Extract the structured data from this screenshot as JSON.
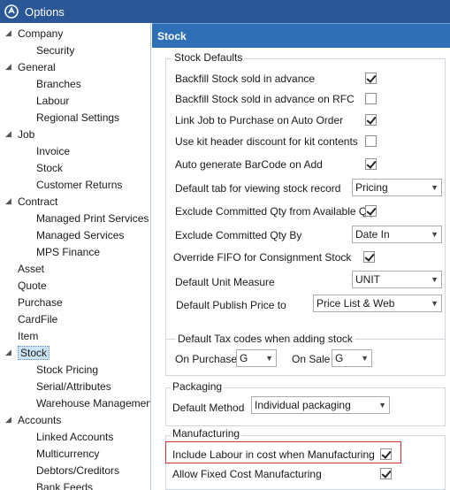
{
  "window": {
    "title": "Options",
    "app_icon": "app-logo-icon"
  },
  "tree": {
    "items": [
      {
        "label": "Company",
        "level": 0,
        "expanded": true
      },
      {
        "label": "Security",
        "level": 1
      },
      {
        "label": "General",
        "level": 0,
        "expanded": true
      },
      {
        "label": "Branches",
        "level": 1
      },
      {
        "label": "Labour",
        "level": 1
      },
      {
        "label": "Regional Settings",
        "level": 1
      },
      {
        "label": "Job",
        "level": 0,
        "expanded": true
      },
      {
        "label": "Invoice",
        "level": 1
      },
      {
        "label": "Stock",
        "level": 1
      },
      {
        "label": "Customer Returns",
        "level": 1
      },
      {
        "label": "Contract",
        "level": 0,
        "expanded": true
      },
      {
        "label": "Managed Print Services",
        "level": 1
      },
      {
        "label": "Managed Services",
        "level": 1
      },
      {
        "label": "MPS Finance",
        "level": 1
      },
      {
        "label": "Asset",
        "level": 0
      },
      {
        "label": "Quote",
        "level": 0
      },
      {
        "label": "Purchase",
        "level": 0
      },
      {
        "label": "CardFile",
        "level": 0
      },
      {
        "label": "Item",
        "level": 0
      },
      {
        "label": "Stock",
        "level": 0,
        "expanded": true,
        "selected": true
      },
      {
        "label": "Stock Pricing",
        "level": 1
      },
      {
        "label": "Serial/Attributes",
        "level": 1
      },
      {
        "label": "Warehouse Management",
        "level": 1
      },
      {
        "label": "Accounts",
        "level": 0,
        "expanded": true
      },
      {
        "label": "Linked Accounts",
        "level": 1
      },
      {
        "label": "Multicurrency",
        "level": 1
      },
      {
        "label": "Debtors/Creditors",
        "level": 1
      },
      {
        "label": "Bank Feeds",
        "level": 1
      }
    ]
  },
  "panel": {
    "header": "Stock",
    "stock_defaults": {
      "title": "Stock Defaults",
      "backfill": {
        "label": "Backfill Stock sold in advance",
        "checked": true
      },
      "backfill_rfc": {
        "label": "Backfill Stock sold in advance on RFC",
        "checked": false
      },
      "link_job": {
        "label": "Link Job to Purchase on Auto Order",
        "checked": true
      },
      "kit_discount": {
        "label": "Use kit header discount for kit contents",
        "checked": false
      },
      "auto_barcode": {
        "label": "Auto generate BarCode on Add",
        "checked": true
      },
      "default_tab": {
        "label": "Default tab for viewing stock record",
        "value": "Pricing"
      },
      "exclude_committed": {
        "label": "Exclude Committed Qty from Available Qty",
        "checked": true
      },
      "exclude_by": {
        "label": "Exclude Committed Qty By",
        "value": "Date In"
      },
      "override_fifo": {
        "label": "Override FIFO for Consignment Stock",
        "checked": true
      },
      "unit_measure": {
        "label": "Default Unit Measure",
        "value": "UNIT"
      },
      "publish_price": {
        "label": "Default Publish Price to",
        "value": "Price List & Web"
      }
    },
    "tax": {
      "title": "Default Tax codes when adding stock",
      "on_purchase_label": "On Purchase",
      "on_purchase_value": "G",
      "on_sale_label": "On Sale",
      "on_sale_value": "G"
    },
    "packaging": {
      "title": "Packaging",
      "method_label": "Default Method",
      "method_value": "Individual packaging"
    },
    "manufacturing": {
      "title": "Manufacturing",
      "include_labour": {
        "label": "Include Labour in cost when Manufacturing",
        "checked": true
      },
      "fixed_cost": {
        "label": "Allow Fixed Cost Manufacturing",
        "checked": true
      }
    }
  },
  "colors": {
    "titlebar": "#2b5797",
    "panel_header": "#2e6fb5",
    "highlight": "#d0312d"
  }
}
